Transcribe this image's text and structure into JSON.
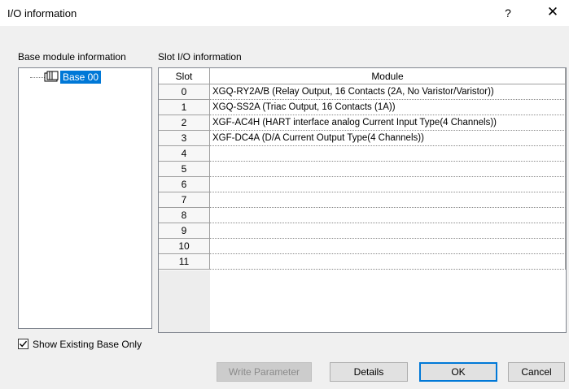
{
  "window": {
    "title": "I/O information",
    "help_label": "?",
    "close_label": "✕"
  },
  "base_panel": {
    "label": "Base module information",
    "tree": [
      {
        "label": "Base 00",
        "selected": true,
        "icon": "base-rack-icon"
      }
    ]
  },
  "slot_panel": {
    "label": "Slot I/O information",
    "columns": [
      "Slot",
      "Module"
    ],
    "rows": [
      {
        "slot": "0",
        "module": "XGQ-RY2A/B (Relay Output, 16 Contacts (2A, No Varistor/Varistor))"
      },
      {
        "slot": "1",
        "module": "XGQ-SS2A (Triac Output, 16 Contacts (1A))"
      },
      {
        "slot": "2",
        "module": "XGF-AC4H (HART interface analog Current Input Type(4 Channels))"
      },
      {
        "slot": "3",
        "module": "XGF-DC4A (D/A Current Output Type(4 Channels))"
      },
      {
        "slot": "4",
        "module": ""
      },
      {
        "slot": "5",
        "module": ""
      },
      {
        "slot": "6",
        "module": ""
      },
      {
        "slot": "7",
        "module": ""
      },
      {
        "slot": "8",
        "module": ""
      },
      {
        "slot": "9",
        "module": ""
      },
      {
        "slot": "10",
        "module": ""
      },
      {
        "slot": "11",
        "module": ""
      }
    ]
  },
  "options": {
    "show_existing_base_only": {
      "label": "Show Existing Base Only",
      "checked": true
    }
  },
  "buttons": {
    "write_parameter": "Write Parameter",
    "details": "Details",
    "ok": "OK",
    "cancel": "Cancel"
  },
  "colors": {
    "selection": "#0078d7",
    "dialog_bg": "#f0f0f0",
    "default_button_border": "#0078d7"
  }
}
